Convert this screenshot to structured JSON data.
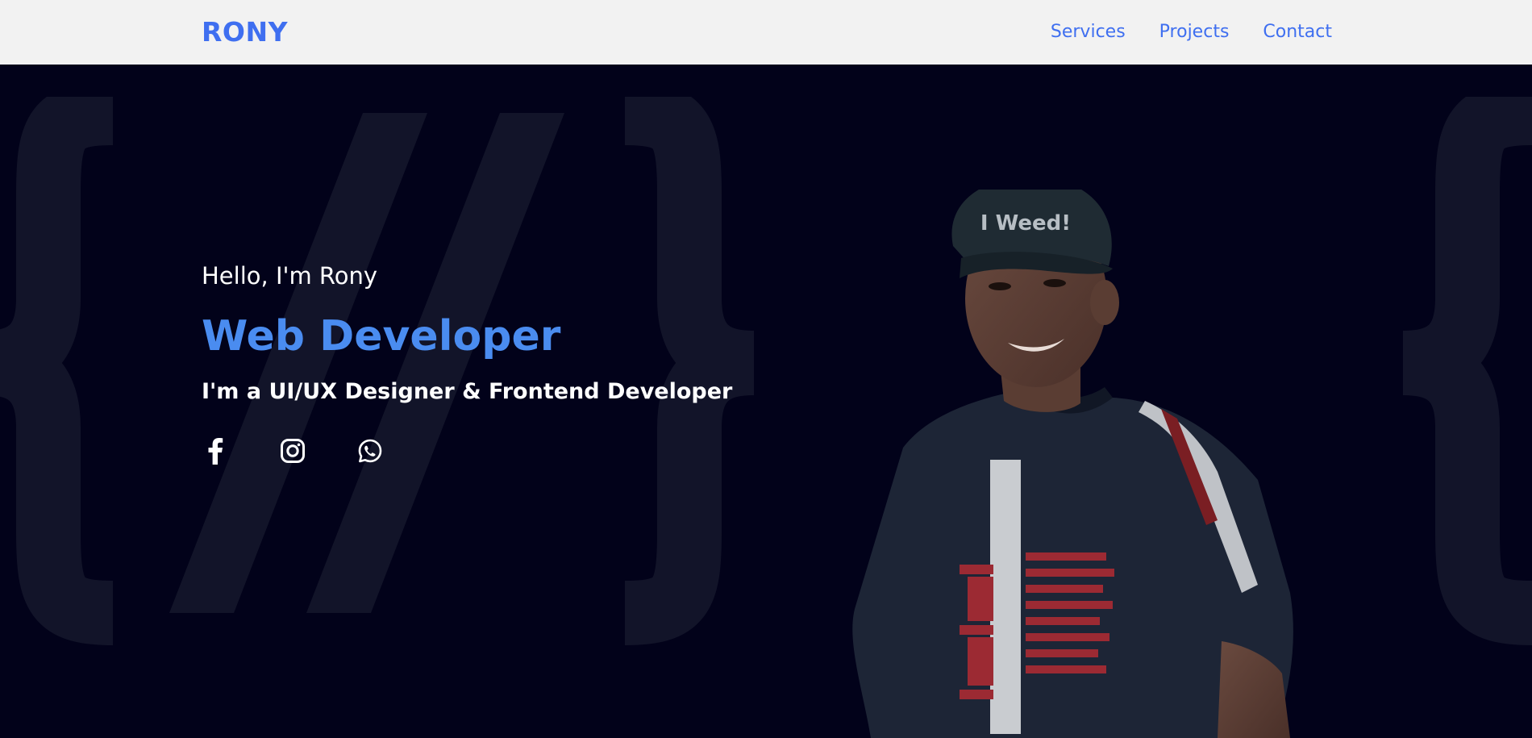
{
  "nav": {
    "logo": "RONY",
    "links": [
      {
        "label": "Services"
      },
      {
        "label": "Projects"
      },
      {
        "label": "Contact"
      }
    ]
  },
  "hero": {
    "greeting": "Hello, I'm Rony",
    "role": "Web Developer",
    "tagline": "I'm a UI/UX Designer & Frontend Developer",
    "socials": [
      {
        "icon": "facebook-icon"
      },
      {
        "icon": "instagram-icon"
      },
      {
        "icon": "whatsapp-icon"
      }
    ],
    "cap_text": "I Weed!"
  },
  "colors": {
    "accent": "#3f6ff0",
    "role": "#4a8cf0",
    "background": "#02021a",
    "navbar": "#f2f2f2"
  }
}
